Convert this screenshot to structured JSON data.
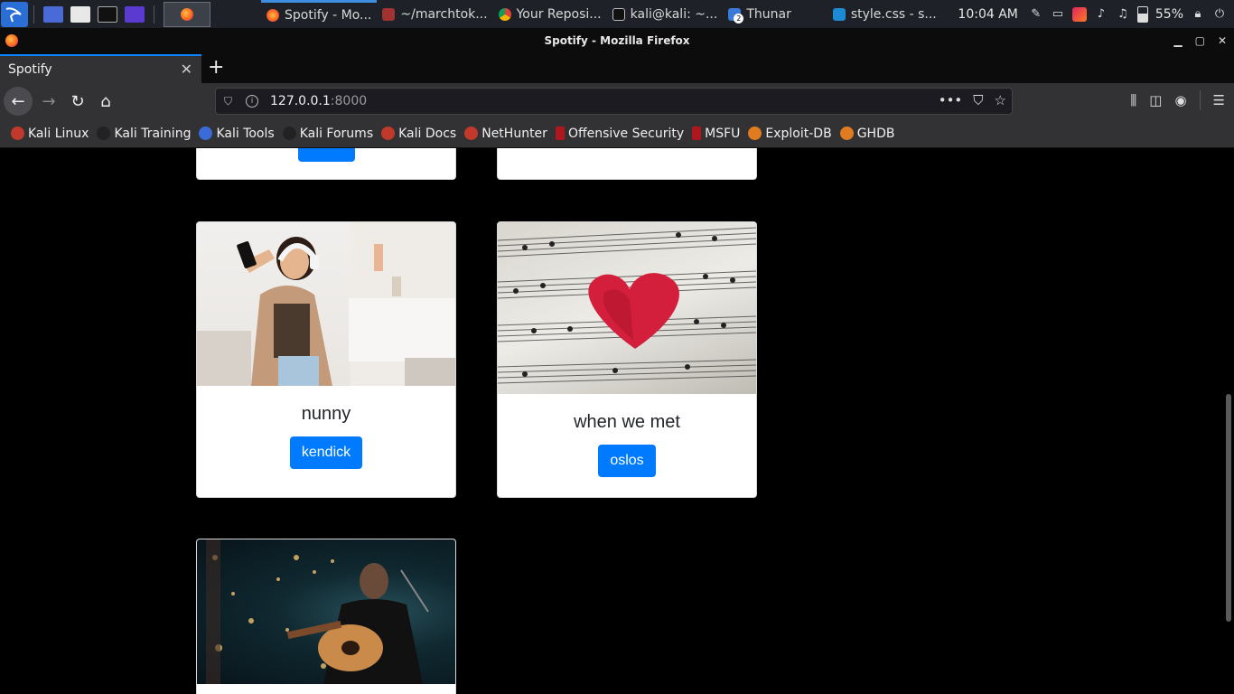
{
  "taskbar": {
    "tasks": [
      {
        "label": "Spotify - Mo...",
        "icon": "firefox-icon"
      },
      {
        "label": "~/marchtok...",
        "icon": "document-icon"
      },
      {
        "label": "Your Reposi...",
        "icon": "chrome-icon"
      },
      {
        "label": "kali@kali: ~...",
        "icon": "terminal-icon"
      },
      {
        "label": "Thunar",
        "icon": "folder-icon"
      },
      {
        "label": "style.css - s...",
        "icon": "vscode-icon"
      }
    ],
    "clock": "10:04 AM",
    "battery": "55%",
    "thunar_badge": "2"
  },
  "window": {
    "title": "Spotify - Mozilla Firefox"
  },
  "browser": {
    "tab_title": "Spotify",
    "url_host": "127.0.0.1",
    "url_port": ":8000",
    "bookmarks": [
      "Kali Linux",
      "Kali Training",
      "Kali Tools",
      "Kali Forums",
      "Kali Docs",
      "NetHunter",
      "Offensive Security",
      "MSFU",
      "Exploit-DB",
      "GHDB"
    ]
  },
  "cards": [
    {
      "title": "nunny",
      "button": "kendick"
    },
    {
      "title": "when we met",
      "button": "oslos"
    }
  ],
  "colors": {
    "accent": "#007bff",
    "page_bg": "#000000",
    "tab_highlight": "#0a84ff"
  }
}
